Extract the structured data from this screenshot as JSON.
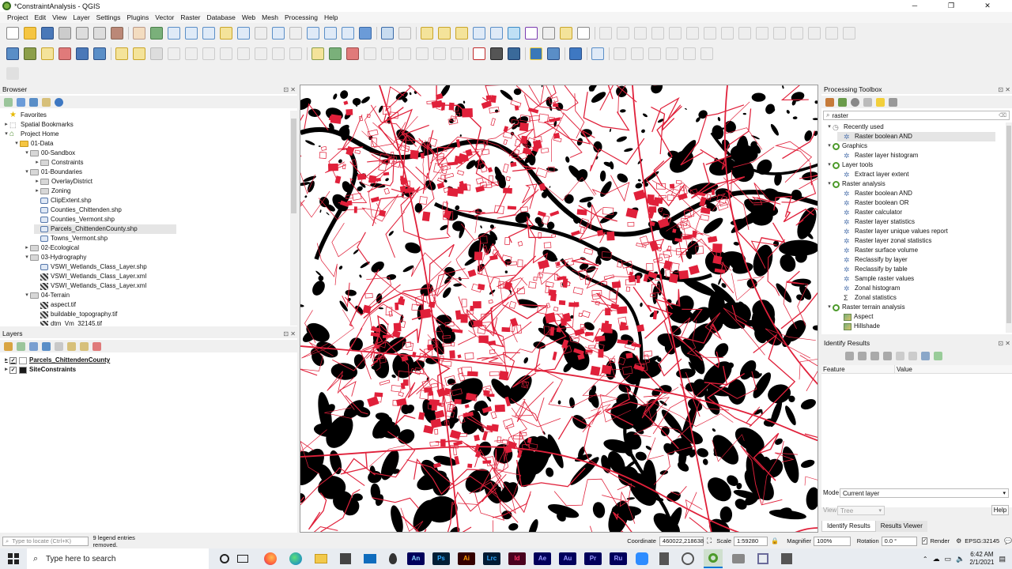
{
  "window": {
    "title": "*ConstraintAnalysis - QGIS",
    "minimize": "─",
    "restore": "❐",
    "close": "✕"
  },
  "menu": [
    "Project",
    "Edit",
    "View",
    "Layer",
    "Settings",
    "Plugins",
    "Vector",
    "Raster",
    "Database",
    "Web",
    "Mesh",
    "Processing",
    "Help"
  ],
  "browser": {
    "title": "Browser",
    "items": [
      {
        "label": "Favorites",
        "icon": "star-icon",
        "depth": 0,
        "arrow": ""
      },
      {
        "label": "Spatial Bookmarks",
        "icon": "bookmark-icon",
        "depth": 0,
        "arrow": "▸"
      },
      {
        "label": "Project Home",
        "icon": "home-icon",
        "depth": 0,
        "arrow": "▾"
      },
      {
        "label": "01-Data",
        "icon": "folder-icon",
        "depth": 1,
        "arrow": "▾"
      },
      {
        "label": "00-Sandbox",
        "icon": "folder-icon",
        "depth": 2,
        "arrow": "▾"
      },
      {
        "label": "Constraints",
        "icon": "folder-icon",
        "depth": 3,
        "arrow": "▸"
      },
      {
        "label": "01-Boundaries",
        "icon": "folder-icon",
        "depth": 2,
        "arrow": "▾"
      },
      {
        "label": "OverlayDistrict",
        "icon": "folder-icon",
        "depth": 3,
        "arrow": "▸"
      },
      {
        "label": "Zoning",
        "icon": "folder-icon",
        "depth": 3,
        "arrow": "▸"
      },
      {
        "label": "ClipExtent.shp",
        "icon": "vector-icon",
        "depth": 3,
        "arrow": ""
      },
      {
        "label": "Counties_Chittenden.shp",
        "icon": "vector-icon",
        "depth": 3,
        "arrow": ""
      },
      {
        "label": "Counties_Vermont.shp",
        "icon": "vector-icon",
        "depth": 3,
        "arrow": ""
      },
      {
        "label": "Parcels_ChittendenCounty.shp",
        "icon": "vector-icon",
        "depth": 3,
        "arrow": "",
        "selected": true
      },
      {
        "label": "Towns_Vermont.shp",
        "icon": "vector-icon",
        "depth": 3,
        "arrow": ""
      },
      {
        "label": "02-Ecological",
        "icon": "folder-icon",
        "depth": 2,
        "arrow": "▸"
      },
      {
        "label": "03-Hydrography",
        "icon": "folder-icon",
        "depth": 2,
        "arrow": "▾"
      },
      {
        "label": "VSWI_Wetlands_Class_Layer.shp",
        "icon": "vector-icon",
        "depth": 3,
        "arrow": ""
      },
      {
        "label": "VSWI_Wetlands_Class_Layer.xml",
        "icon": "raster-icon",
        "depth": 3,
        "arrow": ""
      },
      {
        "label": "VSWI_Wetlands_Class_Layer.xml",
        "icon": "raster-icon",
        "depth": 3,
        "arrow": ""
      },
      {
        "label": "04-Terrain",
        "icon": "folder-icon",
        "depth": 2,
        "arrow": "▾"
      },
      {
        "label": "aspect.tif",
        "icon": "raster-icon",
        "depth": 3,
        "arrow": ""
      },
      {
        "label": "buildable_topography.tif",
        "icon": "raster-icon",
        "depth": 3,
        "arrow": ""
      },
      {
        "label": "dtm_Vm_32145.tif",
        "icon": "raster-icon",
        "depth": 3,
        "arrow": ""
      }
    ]
  },
  "layers": {
    "title": "Layers",
    "items": [
      {
        "label": "Parcels_ChittendenCounty",
        "checked": true,
        "swatch": "#ffffff"
      },
      {
        "label": "SiteConstraints",
        "checked": true,
        "swatch": "#1a1a1a"
      }
    ]
  },
  "toolbox": {
    "title": "Processing Toolbox",
    "search_value": "raster",
    "items": [
      {
        "label": "Recently used",
        "depth": 0,
        "icon": "clock-icon",
        "arrow": "▾"
      },
      {
        "label": "Raster boolean AND",
        "depth": 1,
        "icon": "gear-icon",
        "arrow": ""
      },
      {
        "label": "Graphics",
        "depth": 0,
        "icon": "qgis-icon",
        "arrow": "▾"
      },
      {
        "label": "Raster layer histogram",
        "depth": 1,
        "icon": "gear-icon",
        "arrow": ""
      },
      {
        "label": "Layer tools",
        "depth": 0,
        "icon": "qgis-icon",
        "arrow": "▾"
      },
      {
        "label": "Extract layer extent",
        "depth": 1,
        "icon": "gear-icon",
        "arrow": ""
      },
      {
        "label": "Raster analysis",
        "depth": 0,
        "icon": "qgis-icon",
        "arrow": "▾"
      },
      {
        "label": "Raster boolean AND",
        "depth": 1,
        "icon": "gear-icon",
        "arrow": ""
      },
      {
        "label": "Raster boolean OR",
        "depth": 1,
        "icon": "gear-icon",
        "arrow": ""
      },
      {
        "label": "Raster calculator",
        "depth": 1,
        "icon": "gear-icon",
        "arrow": ""
      },
      {
        "label": "Raster layer statistics",
        "depth": 1,
        "icon": "gear-icon",
        "arrow": ""
      },
      {
        "label": "Raster layer unique values report",
        "depth": 1,
        "icon": "gear-icon",
        "arrow": ""
      },
      {
        "label": "Raster layer zonal statistics",
        "depth": 1,
        "icon": "gear-icon",
        "arrow": ""
      },
      {
        "label": "Raster surface volume",
        "depth": 1,
        "icon": "gear-icon",
        "arrow": ""
      },
      {
        "label": "Reclassify by layer",
        "depth": 1,
        "icon": "gear-icon",
        "arrow": ""
      },
      {
        "label": "Reclassify by table",
        "depth": 1,
        "icon": "gear-icon",
        "arrow": ""
      },
      {
        "label": "Sample raster values",
        "depth": 1,
        "icon": "gear-icon",
        "arrow": ""
      },
      {
        "label": "Zonal histogram",
        "depth": 1,
        "icon": "gear-icon",
        "arrow": ""
      },
      {
        "label": "Zonal statistics",
        "depth": 1,
        "icon": "sigma-icon",
        "arrow": ""
      },
      {
        "label": "Raster terrain analysis",
        "depth": 0,
        "icon": "qgis-icon",
        "arrow": "▾"
      },
      {
        "label": "Aspect",
        "depth": 1,
        "icon": "terrain-icon",
        "arrow": ""
      },
      {
        "label": "Hillshade",
        "depth": 1,
        "icon": "terrain-icon",
        "arrow": ""
      }
    ]
  },
  "identify": {
    "title": "Identify Results",
    "col_feature": "Feature",
    "col_value": "Value",
    "mode_label": "Mode",
    "mode_value": "Current layer",
    "view_label": "View",
    "view_value": "Tree",
    "help_label": "Help",
    "tab_identify": "Identify Results",
    "tab_viewer": "Results Viewer"
  },
  "status": {
    "locate_placeholder": "Type to locate (Ctrl+K)",
    "message": "9 legend entries removed.",
    "coordinate_label": "Coordinate",
    "coordinate_value": "460022,218638",
    "scale_label": "Scale",
    "scale_value": "1:59280",
    "magnifier_label": "Magnifier",
    "magnifier_value": "100%",
    "rotation_label": "Rotation",
    "rotation_value": "0.0 °",
    "render_label": "Render",
    "crs": "EPSG:32145"
  },
  "taskbar": {
    "search_placeholder": "Type here to search",
    "time": "6:42 AM",
    "date": "2/1/2021",
    "apps": [
      {
        "label": "An",
        "color": "#00005b",
        "fg": "#8ad4ff"
      },
      {
        "label": "Ps",
        "color": "#001e36",
        "fg": "#31a8ff"
      },
      {
        "label": "Ai",
        "color": "#330000",
        "fg": "#ff9a00"
      },
      {
        "label": "Lrc",
        "color": "#001a33",
        "fg": "#31a8ff"
      },
      {
        "label": "Id",
        "color": "#49021f",
        "fg": "#ff3366"
      },
      {
        "label": "Ae",
        "color": "#00005b",
        "fg": "#9999ff"
      },
      {
        "label": "Au",
        "color": "#00005b",
        "fg": "#9999ff"
      },
      {
        "label": "Pr",
        "color": "#00005b",
        "fg": "#9999ff"
      },
      {
        "label": "Ru",
        "color": "#00005b",
        "fg": "#9999ff"
      }
    ]
  },
  "colors": {
    "parcel_red": "#e0203a",
    "constraint_black": "#000000",
    "accent": "#0078d7"
  }
}
